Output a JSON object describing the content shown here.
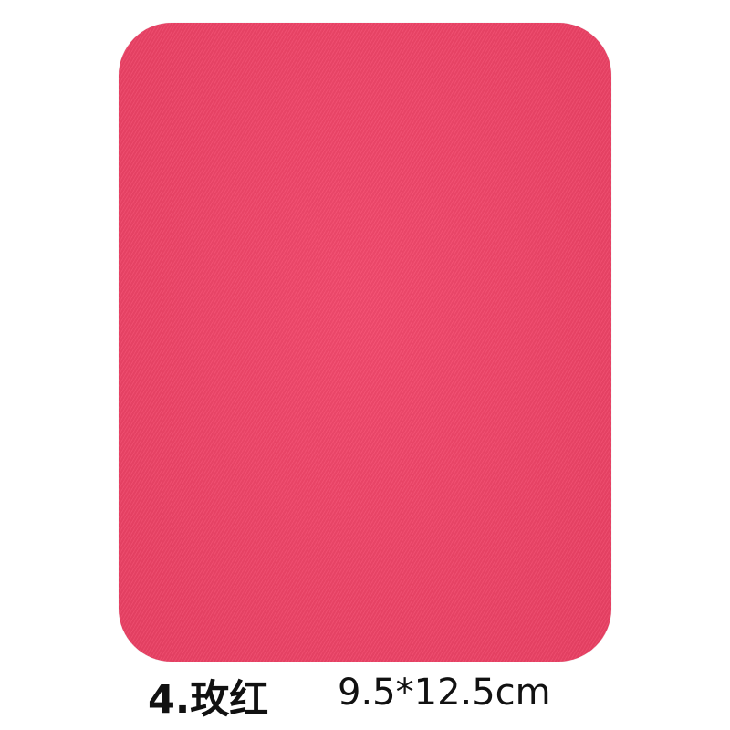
{
  "product": {
    "color": "#f34368",
    "label": "4.玫红",
    "size": "9.5*12.5cm"
  }
}
